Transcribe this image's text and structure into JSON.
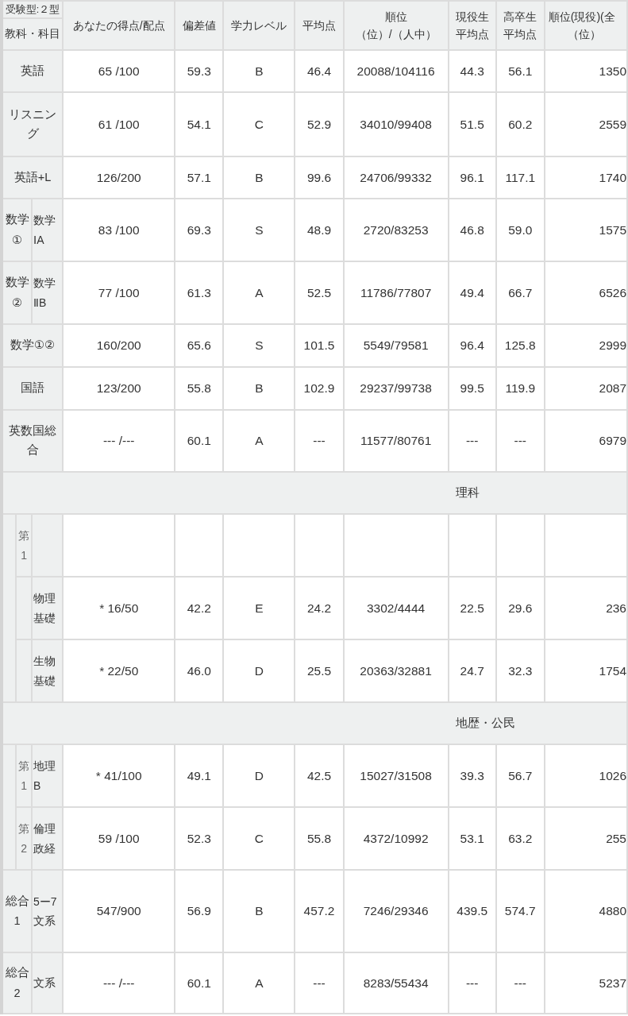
{
  "table": {
    "header": {
      "exam_type": "受験型:２型",
      "subject_label": "教科・科目",
      "columns": [
        [
          "あなたの得点/配点"
        ],
        [
          "偏差値"
        ],
        [
          "学力レベル"
        ],
        [
          "平均点"
        ],
        [
          "順位",
          "（位）/（人中）"
        ],
        [
          "現役生",
          "平均点"
        ],
        [
          "高卒生",
          "平均点"
        ],
        [
          "順位(現役)(全",
          "（位）"
        ]
      ]
    },
    "rows": [
      {
        "kind": "single",
        "name": "英語",
        "values": [
          "65 /100",
          "59.3",
          "B",
          "46.4",
          "20088/104116",
          "44.3",
          "56.1",
          "1350"
        ]
      },
      {
        "kind": "single",
        "name": "リスニング",
        "values": [
          "61 /100",
          "54.1",
          "C",
          "52.9",
          "34010/99408",
          "51.5",
          "60.2",
          "2559"
        ]
      },
      {
        "kind": "single",
        "name": "英語+L",
        "values": [
          "126/200",
          "57.1",
          "B",
          "99.6",
          "24706/99332",
          "96.1",
          "117.1",
          "1740"
        ]
      },
      {
        "kind": "split",
        "group": "数学①",
        "name": "数学ⅠA",
        "values": [
          "83 /100",
          "69.3",
          "S",
          "48.9",
          "2720/83253",
          "46.8",
          "59.0",
          "1575"
        ]
      },
      {
        "kind": "split",
        "group": "数学②",
        "name": "数学ⅡB",
        "values": [
          "77 /100",
          "61.3",
          "A",
          "52.5",
          "11786/77807",
          "49.4",
          "66.7",
          "6526"
        ]
      },
      {
        "kind": "single",
        "name": "数学①②",
        "values": [
          "160/200",
          "65.6",
          "S",
          "101.5",
          "5549/79581",
          "96.4",
          "125.8",
          "2999"
        ]
      },
      {
        "kind": "single",
        "name": "国語",
        "values": [
          "123/200",
          "55.8",
          "B",
          "102.9",
          "29237/99738",
          "99.5",
          "119.9",
          "2087"
        ]
      },
      {
        "kind": "single",
        "name": "英数国総合",
        "values": [
          "--- /---",
          "60.1",
          "A",
          "---",
          "11577/80761",
          "---",
          "---",
          "6979"
        ]
      },
      {
        "kind": "section",
        "title": "理科",
        "items": [
          {
            "ordinal": "第1"
          },
          {
            "name": "物理基礎",
            "values": [
              "* 16/50",
              "42.2",
              "E",
              "24.2",
              "3302/4444",
              "22.5",
              "29.6",
              "236"
            ]
          },
          {
            "name": "生物基礎",
            "values": [
              "* 22/50",
              "46.0",
              "D",
              "25.5",
              "20363/32881",
              "24.7",
              "32.3",
              "1754"
            ]
          }
        ]
      },
      {
        "kind": "section",
        "title": "地歴・公民",
        "items": [
          {
            "ordinal": "第1",
            "name": "地理B",
            "values": [
              "* 41/100",
              "49.1",
              "D",
              "42.5",
              "15027/31508",
              "39.3",
              "56.7",
              "1026"
            ]
          },
          {
            "ordinal": "第2",
            "name": "倫理政経",
            "values": [
              "59 /100",
              "52.3",
              "C",
              "55.8",
              "4372/10992",
              "53.1",
              "63.2",
              "255"
            ]
          }
        ]
      },
      {
        "kind": "split",
        "group": "総合1",
        "name": "5ー7文系",
        "values": [
          "547/900",
          "56.9",
          "B",
          "457.2",
          "7246/29346",
          "439.5",
          "574.7",
          "4880"
        ]
      },
      {
        "kind": "split",
        "group": "総合2",
        "name": "文系",
        "values": [
          "--- /---",
          "60.1",
          "A",
          "---",
          "8283/55434",
          "---",
          "---",
          "5237"
        ]
      }
    ]
  }
}
